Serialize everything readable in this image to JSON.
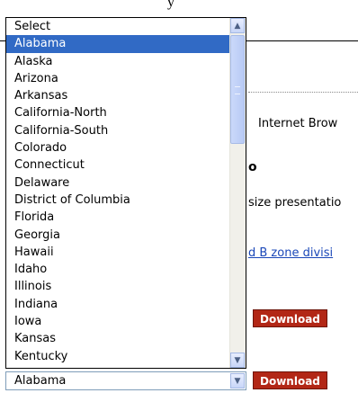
{
  "background": {
    "top_text": "y",
    "line1": "Internet Brow",
    "line2": "o",
    "line3": "size presentatio",
    "link": "d B zone divisi",
    "download_label_1": "Download",
    "download_label_2": "Download"
  },
  "state_select": {
    "selected_value": "Alabama",
    "options": [
      "Select",
      "Alabama",
      "Alaska",
      "Arizona",
      "Arkansas",
      "California-North",
      "California-South",
      "Colorado",
      "Connecticut",
      "Delaware",
      "District of Columbia",
      "Florida",
      "Georgia",
      "Hawaii",
      "Idaho",
      "Illinois",
      "Indiana",
      "Iowa",
      "Kansas",
      "Kentucky"
    ],
    "highlighted_index": 1
  },
  "icons": {
    "scroll_up": "chevron-up-icon",
    "scroll_down": "chevron-down-icon",
    "select_arrow": "chevron-down-icon"
  },
  "colors": {
    "highlight": "#316ac5",
    "download": "#b22716",
    "link": "#1a47b8"
  }
}
